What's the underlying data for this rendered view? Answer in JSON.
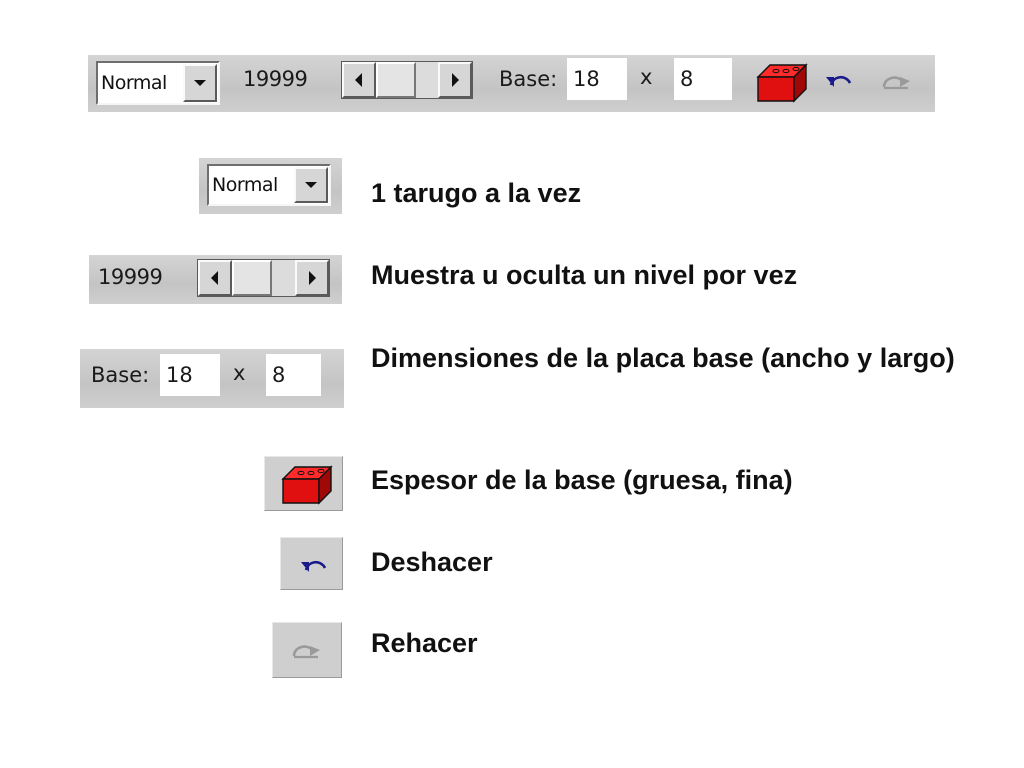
{
  "toolbar": {
    "mode_combo": {
      "value": "Normal"
    },
    "level_value": "19999",
    "base_label": "Base:",
    "width_value": "18",
    "times_label": "x",
    "length_value": "8",
    "icons": {
      "scroll_left": "triangle-left",
      "scroll_right": "triangle-right",
      "dropdown": "triangle-down",
      "brick": "red-brick",
      "undo": "undo-arrow",
      "redo": "redo-arrow"
    },
    "colors": {
      "brick": "#e01010",
      "undo": "#1a1a8a",
      "redo": "#9a9a9a",
      "toolbar_bg": "#c9c9c9"
    }
  },
  "legend": {
    "items": [
      {
        "text": "1 tarugo a la vez"
      },
      {
        "text": "Muestra u oculta un nivel por vez"
      },
      {
        "text": "Dimensiones de la placa base (ancho y largo)"
      },
      {
        "text": "Espesor de la base (gruesa, fina)"
      },
      {
        "text": "Deshacer"
      },
      {
        "text": "Rehacer"
      }
    ]
  }
}
